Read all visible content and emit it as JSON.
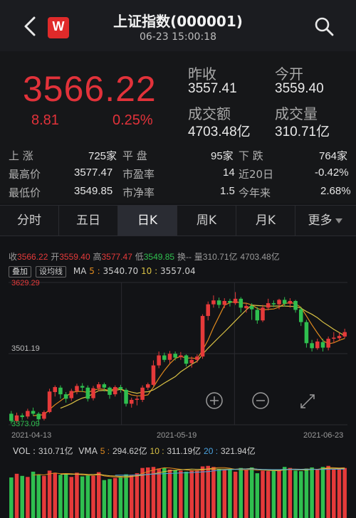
{
  "header": {
    "title": "上证指数(000001)",
    "datetime": "06-23 15:00:18",
    "logo_text": "W"
  },
  "quote": {
    "price": "3566.22",
    "change": "8.81",
    "change_pct": "0.25%",
    "prev_close_label": "昨收",
    "prev_close": "3557.41",
    "open_label": "今开",
    "open": "3559.40",
    "turnover_label": "成交额",
    "turnover": "4703.48亿",
    "volume_label": "成交量",
    "volume": "310.71亿"
  },
  "stats": {
    "up_label": "上  涨",
    "up_val": "725家",
    "flat_label": "平  盘",
    "flat_val": "95家",
    "down_label": "下  跌",
    "down_val": "764家",
    "high_label": "最高价",
    "high_val": "3577.47",
    "pe_label": "市盈率",
    "pe_val": "14",
    "d20_label": "近20日",
    "d20_val": "-0.42%",
    "low_label": "最低价",
    "low_val": "3549.85",
    "pb_label": "市净率",
    "pb_val": "1.5",
    "ytd_label": "今年来",
    "ytd_val": "2.68%"
  },
  "tabs": [
    "分时",
    "五日",
    "日K",
    "周K",
    "月K",
    "更多"
  ],
  "chart_info": {
    "shou_l": "收",
    "shou": "3566.22",
    "kai_l": "开",
    "kai": "3559.40",
    "gao_l": "高",
    "gao": "3577.47",
    "di_l": "低",
    "di": "3549.85",
    "huan_l": "换",
    "huan": "--",
    "liang_l": "量",
    "liang": "310.71亿",
    "e_l": "",
    "e": "4703.48亿",
    "overlay_btn": "叠加",
    "ma_btn": "设均线",
    "ma_label": "MA",
    "ma5_l": "5 :",
    "ma5": "3540.70",
    "ma10_l": "10 :",
    "ma10": "3557.04"
  },
  "vol_info": {
    "vol_label": "VOL :",
    "vol": "310.71亿",
    "vma_label": "VMA",
    "v5_l": "5 :",
    "v5": "294.62亿",
    "v10_l": "10 :",
    "v10": "311.19亿",
    "v20_l": "20 :",
    "v20": "321.94亿"
  },
  "colors": {
    "up": "#e53a3a",
    "down": "#2fbf4f",
    "ma5": "#e08a1e",
    "ma10": "#d8c044",
    "background": "#121316"
  },
  "chart_data": {
    "type": "candlestick",
    "y_labels": [
      "3629.29",
      "3501.19",
      "3373.09"
    ],
    "x_labels": [
      "2021-04-13",
      "2021-05-19",
      "2021-06-23"
    ],
    "ylim": [
      3373.09,
      3629.29
    ],
    "candles": [
      {
        "o": 3393,
        "c": 3380,
        "h": 3398,
        "l": 3375
      },
      {
        "o": 3380,
        "c": 3390,
        "h": 3395,
        "l": 3376
      },
      {
        "o": 3390,
        "c": 3387,
        "h": 3394,
        "l": 3382
      },
      {
        "o": 3388,
        "c": 3398,
        "h": 3402,
        "l": 3384
      },
      {
        "o": 3398,
        "c": 3393,
        "h": 3404,
        "l": 3389
      },
      {
        "o": 3393,
        "c": 3383,
        "h": 3396,
        "l": 3378
      },
      {
        "o": 3384,
        "c": 3396,
        "h": 3399,
        "l": 3381
      },
      {
        "o": 3396,
        "c": 3433,
        "h": 3438,
        "l": 3394
      },
      {
        "o": 3432,
        "c": 3441,
        "h": 3444,
        "l": 3424
      },
      {
        "o": 3440,
        "c": 3428,
        "h": 3444,
        "l": 3420
      },
      {
        "o": 3428,
        "c": 3420,
        "h": 3432,
        "l": 3413
      },
      {
        "o": 3421,
        "c": 3434,
        "h": 3438,
        "l": 3416
      },
      {
        "o": 3434,
        "c": 3443,
        "h": 3447,
        "l": 3428
      },
      {
        "o": 3443,
        "c": 3440,
        "h": 3448,
        "l": 3432
      },
      {
        "o": 3440,
        "c": 3420,
        "h": 3444,
        "l": 3415
      },
      {
        "o": 3421,
        "c": 3439,
        "h": 3443,
        "l": 3417
      },
      {
        "o": 3439,
        "c": 3446,
        "h": 3450,
        "l": 3434
      },
      {
        "o": 3446,
        "c": 3440,
        "h": 3449,
        "l": 3433
      },
      {
        "o": 3440,
        "c": 3427,
        "h": 3442,
        "l": 3420
      },
      {
        "o": 3428,
        "c": 3441,
        "h": 3444,
        "l": 3424
      },
      {
        "o": 3441,
        "c": 3437,
        "h": 3445,
        "l": 3431
      },
      {
        "o": 3436,
        "c": 3411,
        "h": 3439,
        "l": 3406
      },
      {
        "o": 3411,
        "c": 3418,
        "h": 3422,
        "l": 3404
      },
      {
        "o": 3418,
        "c": 3420,
        "h": 3425,
        "l": 3408
      },
      {
        "o": 3418,
        "c": 3440,
        "h": 3444,
        "l": 3414
      },
      {
        "o": 3440,
        "c": 3446,
        "h": 3449,
        "l": 3436
      },
      {
        "o": 3445,
        "c": 3480,
        "h": 3489,
        "l": 3443
      },
      {
        "o": 3480,
        "c": 3498,
        "h": 3505,
        "l": 3475
      },
      {
        "o": 3498,
        "c": 3490,
        "h": 3503,
        "l": 3486
      },
      {
        "o": 3490,
        "c": 3501,
        "h": 3506,
        "l": 3484
      },
      {
        "o": 3501,
        "c": 3494,
        "h": 3505,
        "l": 3489
      },
      {
        "o": 3495,
        "c": 3498,
        "h": 3504,
        "l": 3490
      },
      {
        "o": 3498,
        "c": 3483,
        "h": 3500,
        "l": 3478
      },
      {
        "o": 3484,
        "c": 3490,
        "h": 3496,
        "l": 3476
      },
      {
        "o": 3490,
        "c": 3496,
        "h": 3500,
        "l": 3485
      },
      {
        "o": 3496,
        "c": 3569,
        "h": 3572,
        "l": 3492
      },
      {
        "o": 3569,
        "c": 3590,
        "h": 3595,
        "l": 3561
      },
      {
        "o": 3590,
        "c": 3597,
        "h": 3606,
        "l": 3584
      },
      {
        "o": 3597,
        "c": 3589,
        "h": 3602,
        "l": 3583
      },
      {
        "o": 3589,
        "c": 3596,
        "h": 3601,
        "l": 3583
      },
      {
        "o": 3596,
        "c": 3593,
        "h": 3600,
        "l": 3586
      },
      {
        "o": 3592,
        "c": 3600,
        "h": 3612,
        "l": 3589
      },
      {
        "o": 3600,
        "c": 3584,
        "h": 3603,
        "l": 3575
      },
      {
        "o": 3583,
        "c": 3587,
        "h": 3592,
        "l": 3575
      },
      {
        "o": 3587,
        "c": 3581,
        "h": 3592,
        "l": 3562
      },
      {
        "o": 3580,
        "c": 3561,
        "h": 3585,
        "l": 3555
      },
      {
        "o": 3561,
        "c": 3584,
        "h": 3589,
        "l": 3558
      },
      {
        "o": 3584,
        "c": 3592,
        "h": 3600,
        "l": 3579
      },
      {
        "o": 3592,
        "c": 3590,
        "h": 3597,
        "l": 3585
      },
      {
        "o": 3590,
        "c": 3598,
        "h": 3600,
        "l": 3581
      },
      {
        "o": 3598,
        "c": 3591,
        "h": 3603,
        "l": 3586
      },
      {
        "o": 3591,
        "c": 3596,
        "h": 3601,
        "l": 3584
      },
      {
        "o": 3596,
        "c": 3580,
        "h": 3598,
        "l": 3575
      },
      {
        "o": 3581,
        "c": 3558,
        "h": 3585,
        "l": 3551
      },
      {
        "o": 3558,
        "c": 3520,
        "h": 3562,
        "l": 3512
      },
      {
        "o": 3520,
        "c": 3511,
        "h": 3526,
        "l": 3505
      },
      {
        "o": 3511,
        "c": 3523,
        "h": 3528,
        "l": 3508
      },
      {
        "o": 3522,
        "c": 3512,
        "h": 3528,
        "l": 3505
      },
      {
        "o": 3512,
        "c": 3528,
        "h": 3532,
        "l": 3507
      },
      {
        "o": 3528,
        "c": 3530,
        "h": 3540,
        "l": 3520
      },
      {
        "o": 3529,
        "c": 3533,
        "h": 3539,
        "l": 3524
      },
      {
        "o": 3532,
        "c": 3540,
        "h": 3546,
        "l": 3529
      }
    ],
    "volumes": [
      0.77,
      0.84,
      0.8,
      0.78,
      0.88,
      0.83,
      0.8,
      0.9,
      0.86,
      0.82,
      0.84,
      0.78,
      0.86,
      0.79,
      0.81,
      0.8,
      0.87,
      0.72,
      0.74,
      0.76,
      0.78,
      0.83,
      0.82,
      0.85,
      0.95,
      0.96,
      0.97,
      0.94,
      0.95,
      0.92,
      0.91,
      0.9,
      0.88,
      0.9,
      0.91,
      0.98,
      0.99,
      0.97,
      0.93,
      0.91,
      0.92,
      0.88,
      0.95,
      0.91,
      0.96,
      0.85,
      0.9,
      0.89,
      0.91,
      0.92,
      0.97,
      0.95,
      0.9,
      0.89,
      0.94,
      0.96,
      0.93,
      0.97,
      0.99,
      0.92,
      0.94,
      0.95
    ]
  }
}
